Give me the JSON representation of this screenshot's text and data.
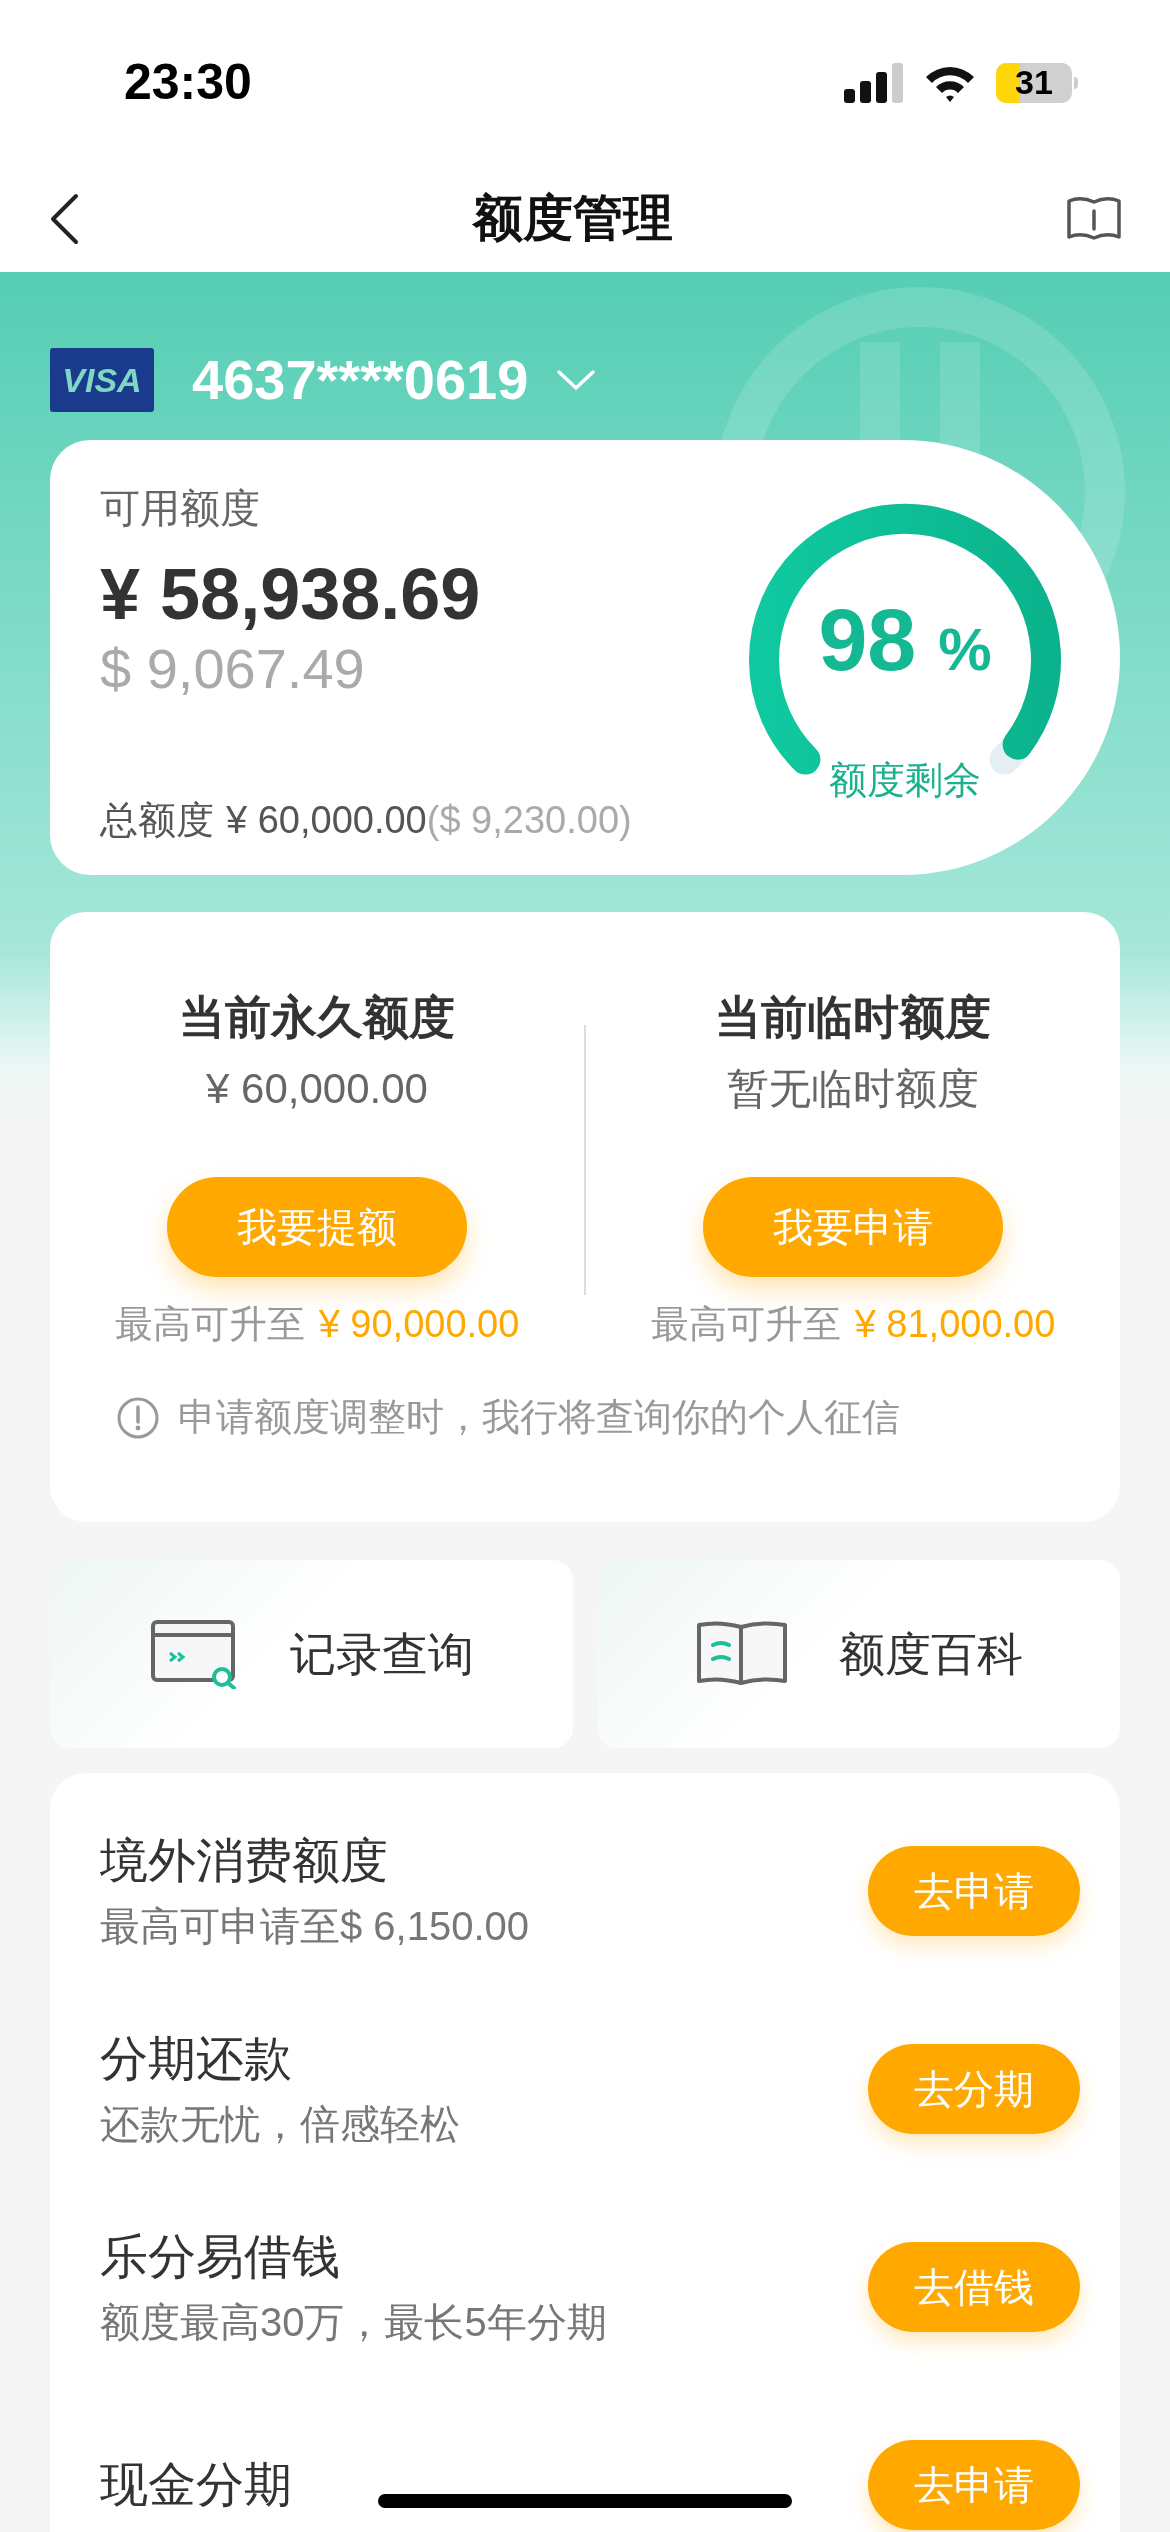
{
  "status_bar": {
    "time": "23:30",
    "battery": "31"
  },
  "nav": {
    "title": "额度管理"
  },
  "card": {
    "brand": "VISA",
    "number": "4637****0619"
  },
  "available": {
    "label": "可用额度",
    "amount": "¥ 58,938.69",
    "amount_usd": "$ 9,067.49",
    "total_label": "总额度",
    "total": "¥ 60,000.00",
    "total_usd": "($ 9,230.00)",
    "gauge": {
      "value": "98",
      "unit": "%",
      "caption": "额度剩余"
    }
  },
  "limits": [
    {
      "title": "当前永久额度",
      "value": "¥ 60,000.00",
      "button": "我要提额",
      "max_label": "最高可升至",
      "max_value": "¥ 90,000.00"
    },
    {
      "title": "当前临时额度",
      "value": "暂无临时额度",
      "button": "我要申请",
      "max_label": "最高可升至",
      "max_value": "¥ 81,000.00"
    }
  ],
  "notice": "申请额度调整时，我行将查询你的个人征信",
  "shortcuts": [
    {
      "kind": "records",
      "label": "记录查询"
    },
    {
      "kind": "guide",
      "label": "额度百科"
    }
  ],
  "services": [
    {
      "title": "境外消费额度",
      "subtitle": "最高可申请至$ 6,150.00",
      "button": "去申请"
    },
    {
      "title": "分期还款",
      "subtitle": "还款无忧，倍感轻松",
      "button": "去分期"
    },
    {
      "title": "乐分易借钱",
      "subtitle": "额度最高30万，最长5年分期",
      "button": "去借钱"
    },
    {
      "title": "现金分期",
      "button": "去申请"
    }
  ]
}
